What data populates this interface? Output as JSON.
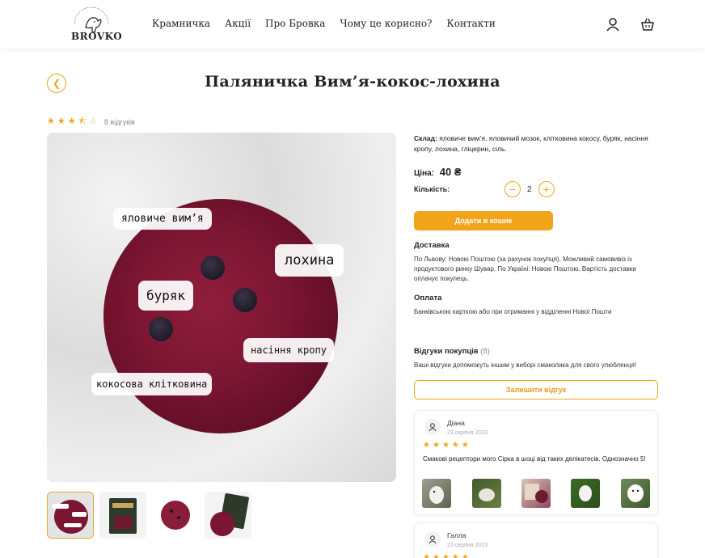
{
  "header": {
    "logo_text": "BROVKO",
    "nav": [
      "Крамничка",
      "Акції",
      "Про Бровка",
      "Чому це корисно?",
      "Контакти"
    ],
    "icons": [
      "user-icon",
      "cart-icon"
    ]
  },
  "product": {
    "title": "Паляничка Вим’я-кокос-лохина",
    "rating_stars": 3.5,
    "reviews_count_text": "8 відгуків",
    "image_tags": [
      "яловиче вим’я",
      "лохина",
      "буряк",
      "насіння кропу",
      "кокосова клітковина"
    ],
    "composition_label": "Склад:",
    "composition_text": "яловиче вим’я, яловичий мозок, клітковина кокосу, буряк, насіння кропу, лохина, гліцерин, сіль.",
    "price_label": "Ціна:",
    "price_value": "40 ₴",
    "quantity_label": "Кількість:",
    "quantity_value": "2",
    "add_to_cart": "Додати в кошик"
  },
  "delivery": {
    "title": "Доставка",
    "text": "По Львову: Новою Поштою (за рахунок покупця). Можливий самовивіз із продуктового ринку Шувар. По Україні: Новою Поштою. Вартість доставки оплачує покупець."
  },
  "payment": {
    "title": "Оплата",
    "text": "Банківською карткою або при отриманні у відділенні Нової Пошти"
  },
  "reviews": {
    "title": "Відгуки покупців",
    "count": "(8)",
    "subtitle": "Ваші відгуки допоможуть іншим у виборі смаколика для свого улюбленця!",
    "leave_button": "Залишити відгук",
    "items": [
      {
        "name": "Діана",
        "date": "23 серпня 2023",
        "stars": 5,
        "text": "Смакові рецептори мого Сірка в шоці від таких делікатесів. Однозначно 5!"
      },
      {
        "name": "Галла",
        "date": "23 серпня 2023",
        "stars": 5,
        "text": ""
      }
    ]
  },
  "colors": {
    "accent": "#f0a51a",
    "beet": "#7a1532"
  }
}
